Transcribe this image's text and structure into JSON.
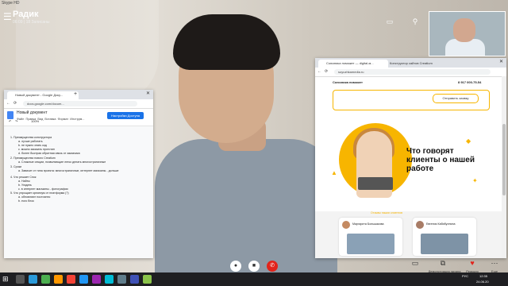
{
  "app": {
    "window_title": "Skype HD"
  },
  "call": {
    "name": "Радик",
    "subtitle": "06:09 | 18 Записаны",
    "controls": {
      "share_label": "Демонстрация экрана",
      "react_label": "Реакция",
      "more_label": "Еще"
    }
  },
  "docs_window": {
    "tab_title": "Новый документ - Google Доку...",
    "url": "docs.google.com/docum...",
    "doc_title": "Новый документ",
    "menu": [
      "Файл",
      "Правка",
      "Вид",
      "Вставка",
      "Формат",
      "Инструм..."
    ],
    "share_button": "Настройки Доступа",
    "zoom": "100%",
    "lines": [
      "1.   Преимущества конструктора",
      "a.   лучше работать",
      "b.   не нужно знать код",
      "c.   можно заказать прототип",
      "d.   более быстрая обратная связь от заказчика",
      "2.   Преимущества нового Creatium",
      "a.   Сложные секции, позволяющие легко делать многостраничные",
      "3.   Сроки",
      "a.   Зависит от типа проекта: многостраничные, интернет магазины - дольше",
      "4.   Что решает Спок",
      "a.   Найты",
      "b.   Угадать",
      "c.   в интернет магазины - фотографии",
      "5.   Что упрощает креатиум от платформа (?)",
      "a.   обновляют постоянно",
      "b.   euro блок"
    ]
  },
  "site_window": {
    "tabs": [
      "Союзника поможет — digital-м...",
      "Конструктор сайтов Creatium"
    ],
    "url": "soyuzhkamedia.ru",
    "brand": "Союзника поможет",
    "phone": "8 917 000-75-54",
    "cta": "Отправить заявку",
    "hero_title": "Что говорят клиенты о нашей работе",
    "reviews_label": "Отзывы наших клиентов",
    "reviewers": [
      "Маргарита Большакова",
      "Евгения Кабибуллина"
    ]
  },
  "taskbar": {
    "time": "12:35",
    "date": "24.06.20",
    "lang": "РУС"
  },
  "colors": {
    "accent": "#f7b500",
    "end_call": "#e2231a",
    "docs_blue": "#1a73e8"
  },
  "icons": [
    "menu-icon",
    "add-person-icon",
    "layout-icon",
    "gear-icon",
    "mic-icon",
    "video-icon",
    "end-call-icon",
    "share-screen-icon",
    "heart-icon",
    "more-icon",
    "windows-start-icon"
  ]
}
